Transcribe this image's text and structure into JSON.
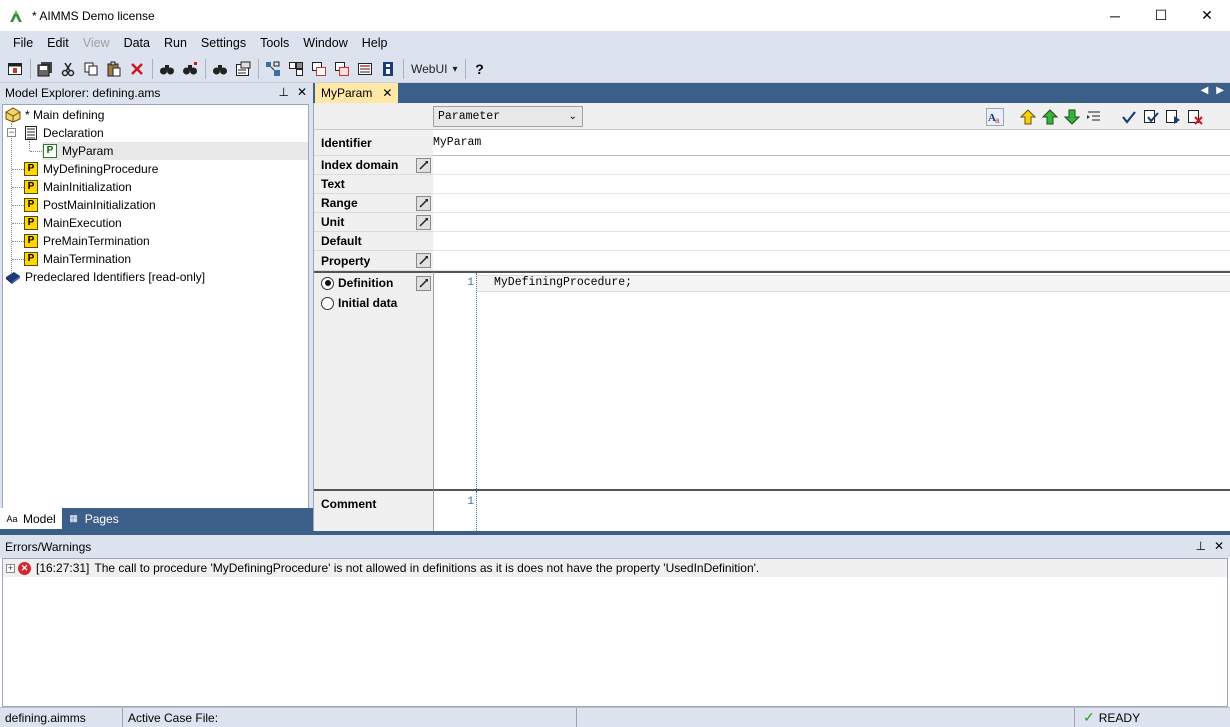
{
  "window": {
    "title": "* AIMMS Demo license",
    "minimize": "─",
    "maximize": "☐",
    "close": "✕"
  },
  "menu": [
    "File",
    "Edit",
    "View",
    "Data",
    "Run",
    "Settings",
    "Tools",
    "Window",
    "Help"
  ],
  "toolbar": {
    "webui_label": "WebUI",
    "webui_arrow": "▾",
    "help": "?"
  },
  "explorer": {
    "title": "Model Explorer: defining.ams",
    "pin": "⊥",
    "close": "✕",
    "tree": [
      {
        "label": "* Main defining",
        "icon": "main-model-icon"
      },
      {
        "label": "Declaration",
        "icon": "declaration-icon"
      },
      {
        "label": "MyParam",
        "icon": "parameter-icon",
        "icon_letter": "P",
        "selected": true
      },
      {
        "label": "MyDefiningProcedure",
        "icon": "procedure-icon",
        "icon_letter": "P"
      },
      {
        "label": "MainInitialization",
        "icon": "procedure-icon",
        "icon_letter": "P"
      },
      {
        "label": "PostMainInitialization",
        "icon": "procedure-icon",
        "icon_letter": "P"
      },
      {
        "label": "MainExecution",
        "icon": "procedure-icon",
        "icon_letter": "P"
      },
      {
        "label": "PreMainTermination",
        "icon": "procedure-icon",
        "icon_letter": "P"
      },
      {
        "label": "MainTermination",
        "icon": "procedure-icon",
        "icon_letter": "P"
      },
      {
        "label": "Predeclared Identifiers [read-only]",
        "icon": "library-icon"
      }
    ],
    "expander_minus": "−",
    "tabs": [
      {
        "label": "Model",
        "icon_text": "Aa"
      },
      {
        "label": "Pages",
        "icon_text": "▦"
      }
    ]
  },
  "editor": {
    "tab_label": "MyParam",
    "tab_close": "✕",
    "tab_nav_left": "◀",
    "tab_nav_right": "▶",
    "type_value": "Parameter",
    "type_arrow": "⌄",
    "attributes": [
      {
        "label": "Identifier",
        "value": "MyParam"
      },
      {
        "label": "Index domain",
        "value": ""
      },
      {
        "label": "Text",
        "value": ""
      },
      {
        "label": "Range",
        "value": ""
      },
      {
        "label": "Unit",
        "value": ""
      },
      {
        "label": "Default",
        "value": ""
      },
      {
        "label": "Property",
        "value": ""
      }
    ],
    "definition_label": "Definition",
    "initial_data_label": "Initial data",
    "definition_line_number": "1",
    "definition_code": "MyDefiningProcedure;",
    "comment_label": "Comment",
    "comment_line_number": "1",
    "comment_code": ""
  },
  "errors": {
    "title": "Errors/Warnings",
    "pin": "⊥",
    "close": "✕",
    "rows": [
      {
        "time": "[16:27:31]",
        "message": "The call to procedure 'MyDefiningProcedure' is not allowed in definitions as it is does not have the property 'UsedInDefinition'."
      }
    ],
    "expander_plus": "+",
    "error_symbol": "✕"
  },
  "status": {
    "file": "defining.aimms",
    "case_label": "Active Case File:",
    "state_mark": "✓",
    "state": "READY"
  },
  "colors": {
    "chrome": "#dde3ee",
    "accent": "#3c5f8a",
    "active_doc_tab": "#ffe8a6",
    "error": "#d9262c",
    "procedure_icon": "#ffd700"
  }
}
